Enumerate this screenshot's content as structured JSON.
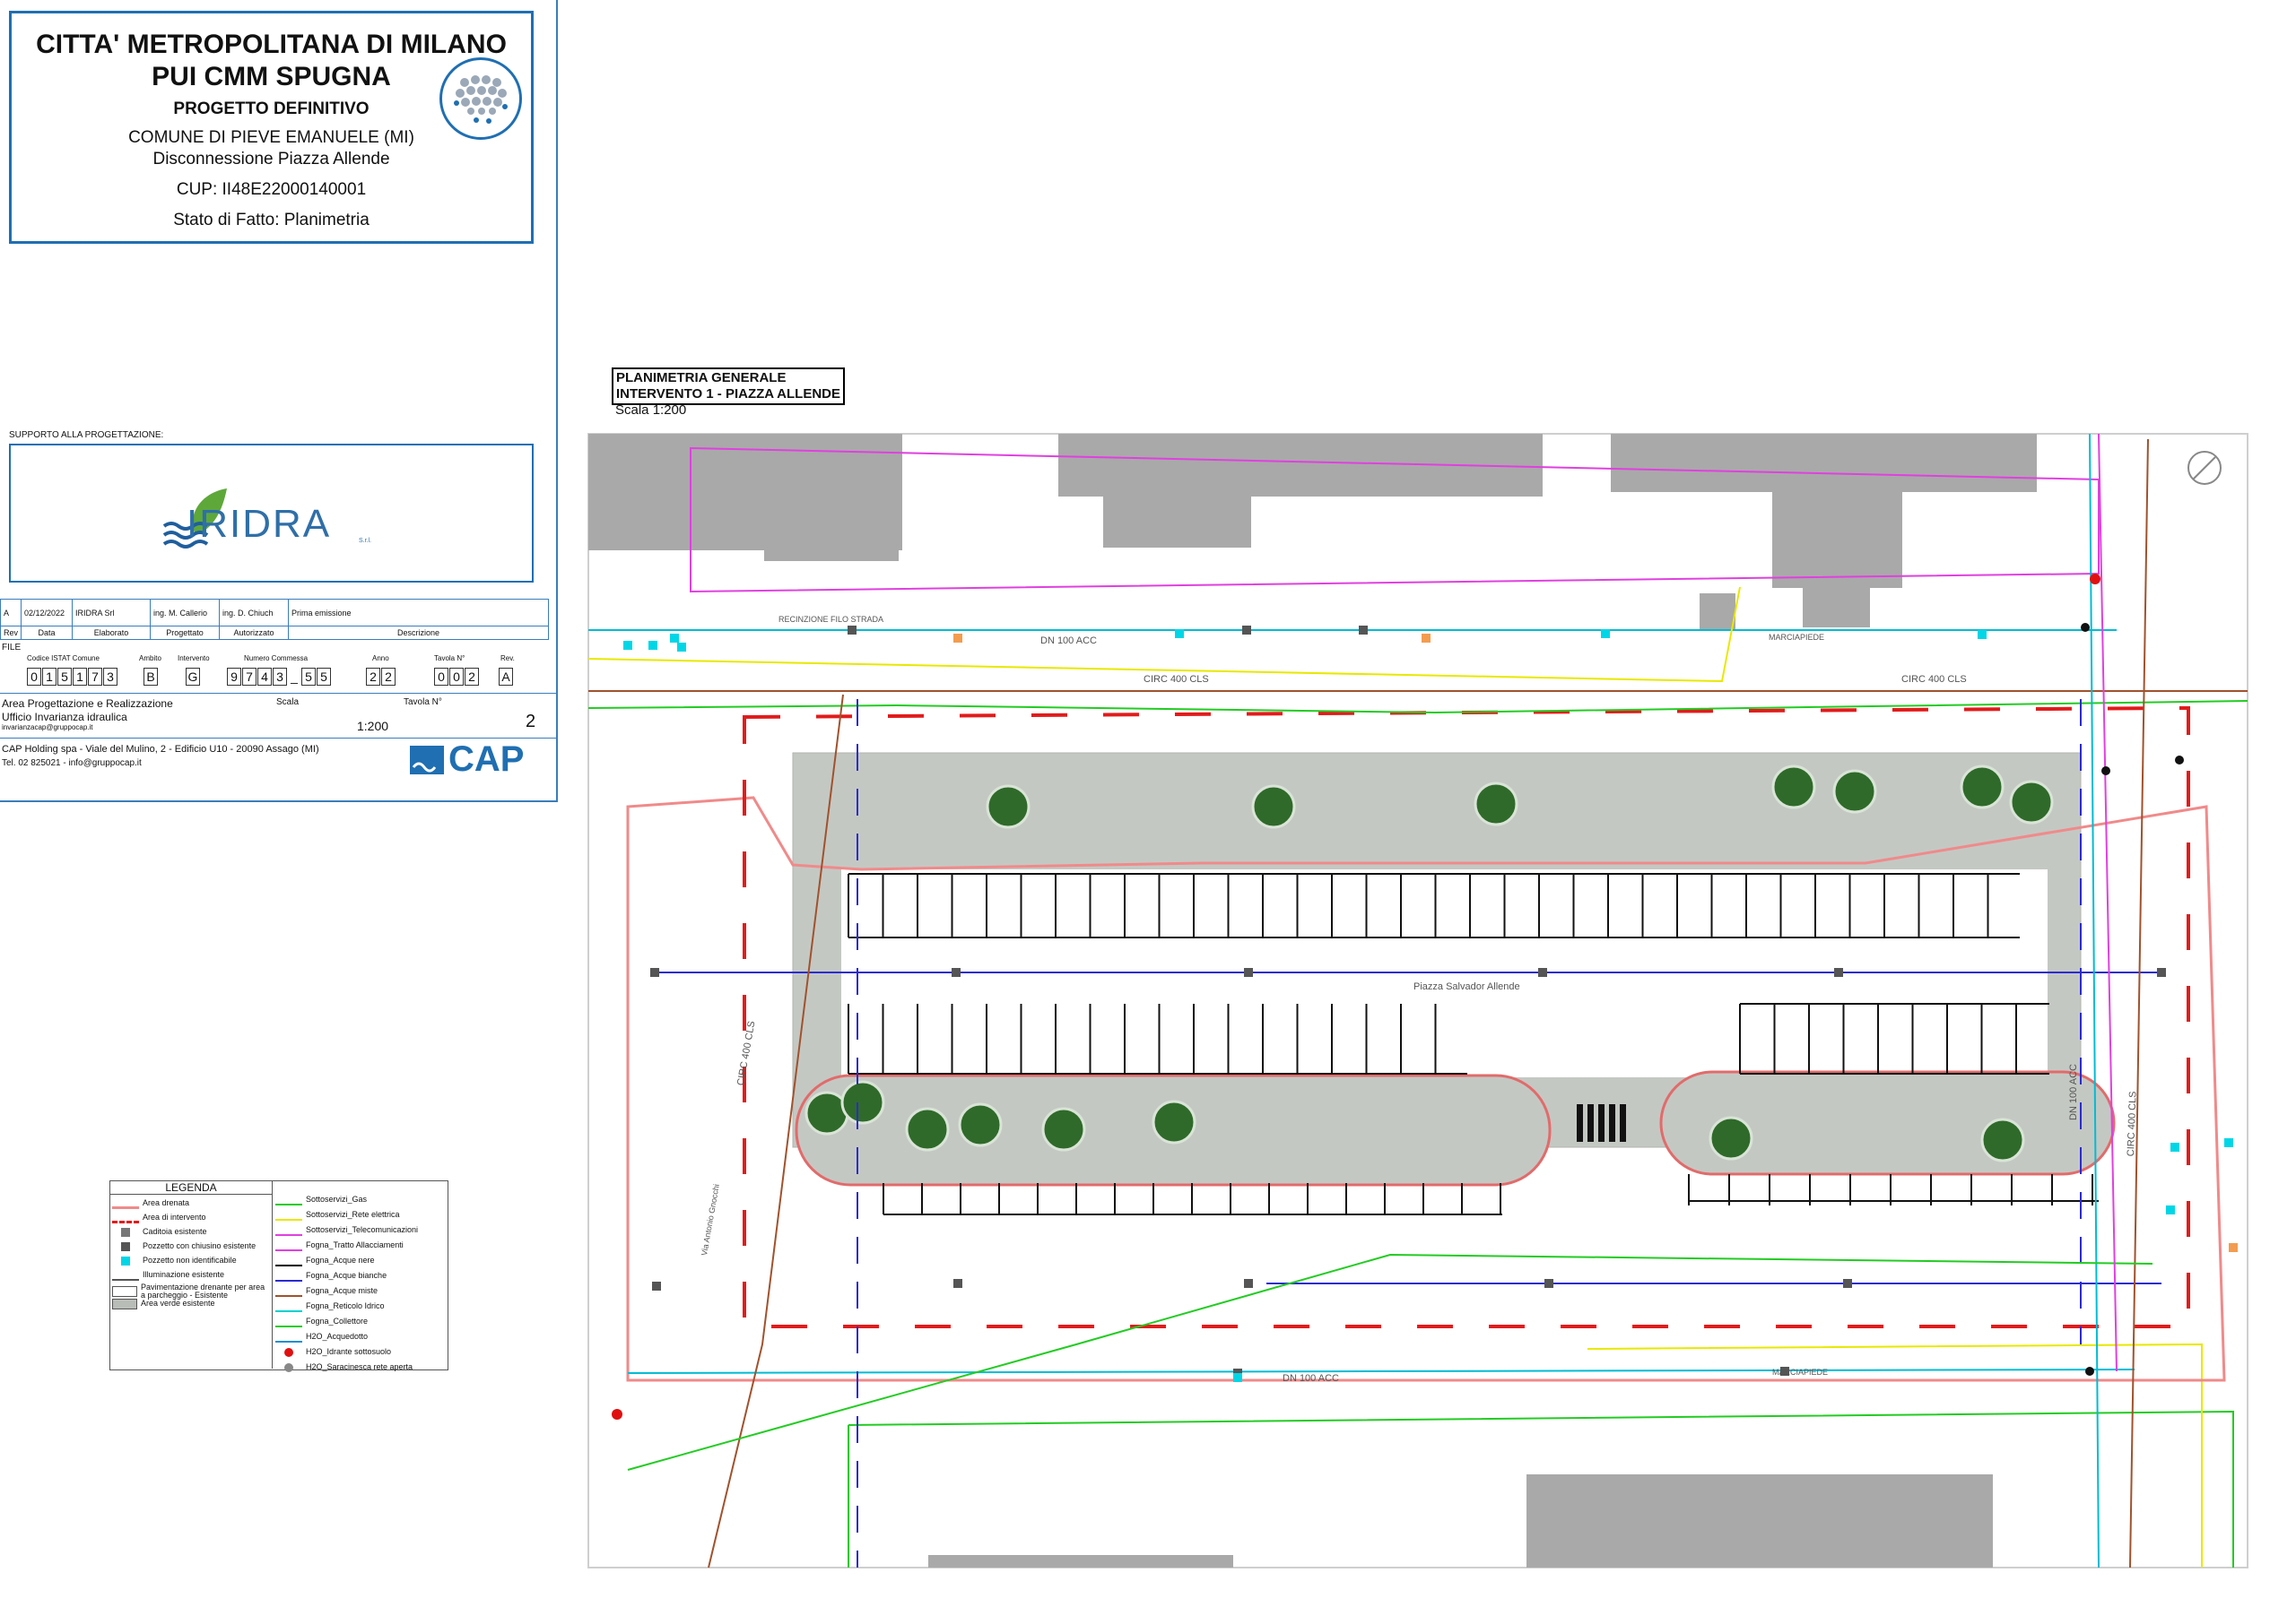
{
  "title_block": {
    "line1": "CITTA' METROPOLITANA DI MILANO",
    "line2": "PUI CMM SPUGNA",
    "line3": "PROGETTO DEFINITIVO",
    "comune": "COMUNE DI PIEVE EMANUELE (MI)",
    "project": "Disconnessione Piazza Allende",
    "cup": "CUP: II48E22000140001",
    "stato": "Stato di Fatto: Planimetria"
  },
  "support": {
    "label": "SUPPORTO ALLA PROGETTAZIONE:",
    "logo_text": "IRIDRA",
    "logo_sub": "S.r.l."
  },
  "revision": {
    "rev": "A",
    "date": "02/12/2022",
    "elaborato": "IRIDRA Srl",
    "progettato": "ing. M. Callerio",
    "autorizzato": "ing. D. Chiuch",
    "descrizione": "Prima emissione",
    "headers": [
      "Rev",
      "Data",
      "Elaborato",
      "Progettato",
      "Autorizzato",
      "Descrizione"
    ]
  },
  "file": {
    "label": "FILE",
    "codice_label": "Codice ISTAT Comune",
    "codice": [
      "0",
      "1",
      "5",
      "1",
      "7",
      "3"
    ],
    "ambito_label": "Ambito",
    "ambito": "B",
    "intervento_label": "Intervento",
    "intervento": "G",
    "commessa_label": "Numero Commessa",
    "commessa": [
      "9",
      "7",
      "4",
      "3",
      "_",
      "5",
      "5"
    ],
    "anno_label": "Anno",
    "anno": [
      "2",
      "2"
    ],
    "tavola_label": "Tavola N°",
    "tavola": [
      "0",
      "0",
      "2"
    ],
    "rev_label": "Rev.",
    "rev": "A"
  },
  "office": {
    "area": "Area Progettazione e Realizzazione",
    "ufficio": "Ufficio Invarianza idraulica",
    "email": "invarianzacap@gruppocap.it",
    "scala_label": "Scala",
    "scala": "1:200",
    "tavola_label": "Tavola N°",
    "tavola": "2",
    "address": "CAP Holding spa - Viale del Mulino, 2 - Edificio U10 - 20090 Assago (MI)",
    "contacts": "Tel. 02 825021 - info@gruppocap.it",
    "cap_logo": "CAP"
  },
  "legend": {
    "title": "LEGENDA",
    "left": [
      {
        "label": "Area drenata",
        "symbol": "line",
        "color": "#f08a8a"
      },
      {
        "label": "Area di intervento",
        "symbol": "dash",
        "color": "#e21b1b"
      },
      {
        "label": "Caditoia esistente",
        "symbol": "square",
        "color": "#777777"
      },
      {
        "label": "Pozzetto con chiusino esistente",
        "symbol": "square",
        "color": "#555555"
      },
      {
        "label": "Pozzetto non identificabile",
        "symbol": "square",
        "color": "#00d6e6"
      },
      {
        "label": "Illuminazione esistente",
        "symbol": "lamp",
        "color": "#555555"
      },
      {
        "label": "Pavimentazione drenante per area a parcheggio - Esistente",
        "symbol": "box",
        "color": "#ffffff"
      },
      {
        "label": "Area verde esistente",
        "symbol": "box",
        "color": "#b9bdb7"
      }
    ],
    "right": [
      {
        "label": "Sottoservizi_Gas",
        "color": "#22cc22"
      },
      {
        "label": "Sottoservizi_Rete elettrica",
        "color": "#e8e800"
      },
      {
        "label": "Sottoservizi_Telecomunicazioni",
        "color": "#e040e0"
      },
      {
        "label": "Fogna_Tratto Allacciamenti",
        "color": "#e040e0"
      },
      {
        "label": "Fogna_Acque nere",
        "color": "#000000"
      },
      {
        "label": "Fogna_Acque bianche",
        "color": "#2b2bd0"
      },
      {
        "label": "Fogna_Acque miste",
        "color": "#a0522d"
      },
      {
        "label": "Fogna_Reticolo Idrico",
        "color": "#00d0d0"
      },
      {
        "label": "Fogna_Collettore",
        "color": "#22cc22"
      },
      {
        "label": "H2O_Acquedotto",
        "color": "#1f8fd0"
      },
      {
        "label": "H2O_Idrante sottosuolo",
        "color": "#e01010"
      },
      {
        "label": "H2O_Saracinesca rete aperta",
        "color": "#888888"
      }
    ]
  },
  "plan": {
    "title_line1": "PLANIMETRIA GENERALE",
    "title_line2": "INTERVENTO 1 - PIAZZA ALLENDE",
    "scale": "Scala 1:200",
    "labels": {
      "dn_top": "DN 100 ACC",
      "dn_bottom": "DN 100 ACC",
      "circ_left_top": "CIRC 400 CLS",
      "circ_right_top": "CIRC 400 CLS",
      "circ_left": "CIRC 400 CLS",
      "circ_right": "CIRC 400 CLS",
      "dn_right": "DN 100 ACC",
      "piazza": "Piazza Salvador Allende",
      "marciapiede_top": "MARCIAPIEDE",
      "marciapiede_bottom": "MARCIAPIEDE",
      "recinzione": "RECINZIONE FILO STRADA",
      "via": "Via Antonio Gnocchi"
    }
  }
}
